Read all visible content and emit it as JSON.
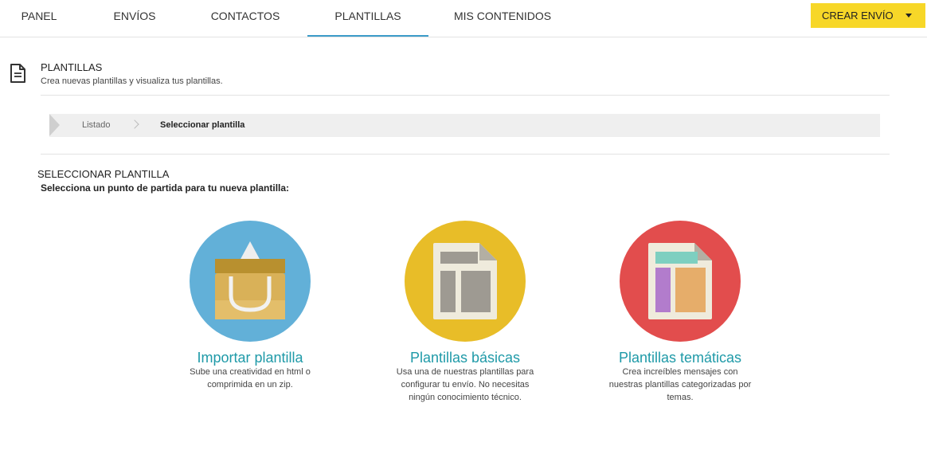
{
  "nav": {
    "tabs": [
      {
        "label": "PANEL"
      },
      {
        "label": "ENVÍOS"
      },
      {
        "label": "CONTACTOS"
      },
      {
        "label": "PLANTILLAS"
      },
      {
        "label": "MIS CONTENIDOS"
      }
    ],
    "active_tab": "PLANTILLAS",
    "cta_label": "CREAR ENVÍO"
  },
  "header": {
    "title": "PLANTILLAS",
    "subtitle": "Crea nuevas plantillas y visualiza tus plantillas."
  },
  "breadcrumb": {
    "items": [
      "Listado",
      "Seleccionar plantilla"
    ]
  },
  "section": {
    "title": "SELECCIONAR PLANTILLA",
    "subtitle": "Selecciona un punto de partida para tu nueva plantilla:"
  },
  "options": [
    {
      "title": "Importar plantilla",
      "desc": [
        "Sube una creatividad en html o",
        "comprimida en un zip."
      ]
    },
    {
      "title": "Plantillas básicas",
      "desc": [
        "Usa una de nuestras plantillas para",
        "configurar tu envío. No necesitas",
        "ningún conocimiento técnico."
      ]
    },
    {
      "title": "Plantillas temáticas",
      "desc": [
        "Crea increíbles mensajes con",
        "nuestras plantillas categorizadas por",
        "temas."
      ]
    }
  ],
  "colors": {
    "accent_cta": "#f7d728",
    "active_underline": "#3c9cc9",
    "link_title": "#1f9aa8",
    "import_circle": "#62b0d8",
    "basic_circle": "#e8bd28",
    "themed_circle": "#e24d4d"
  }
}
